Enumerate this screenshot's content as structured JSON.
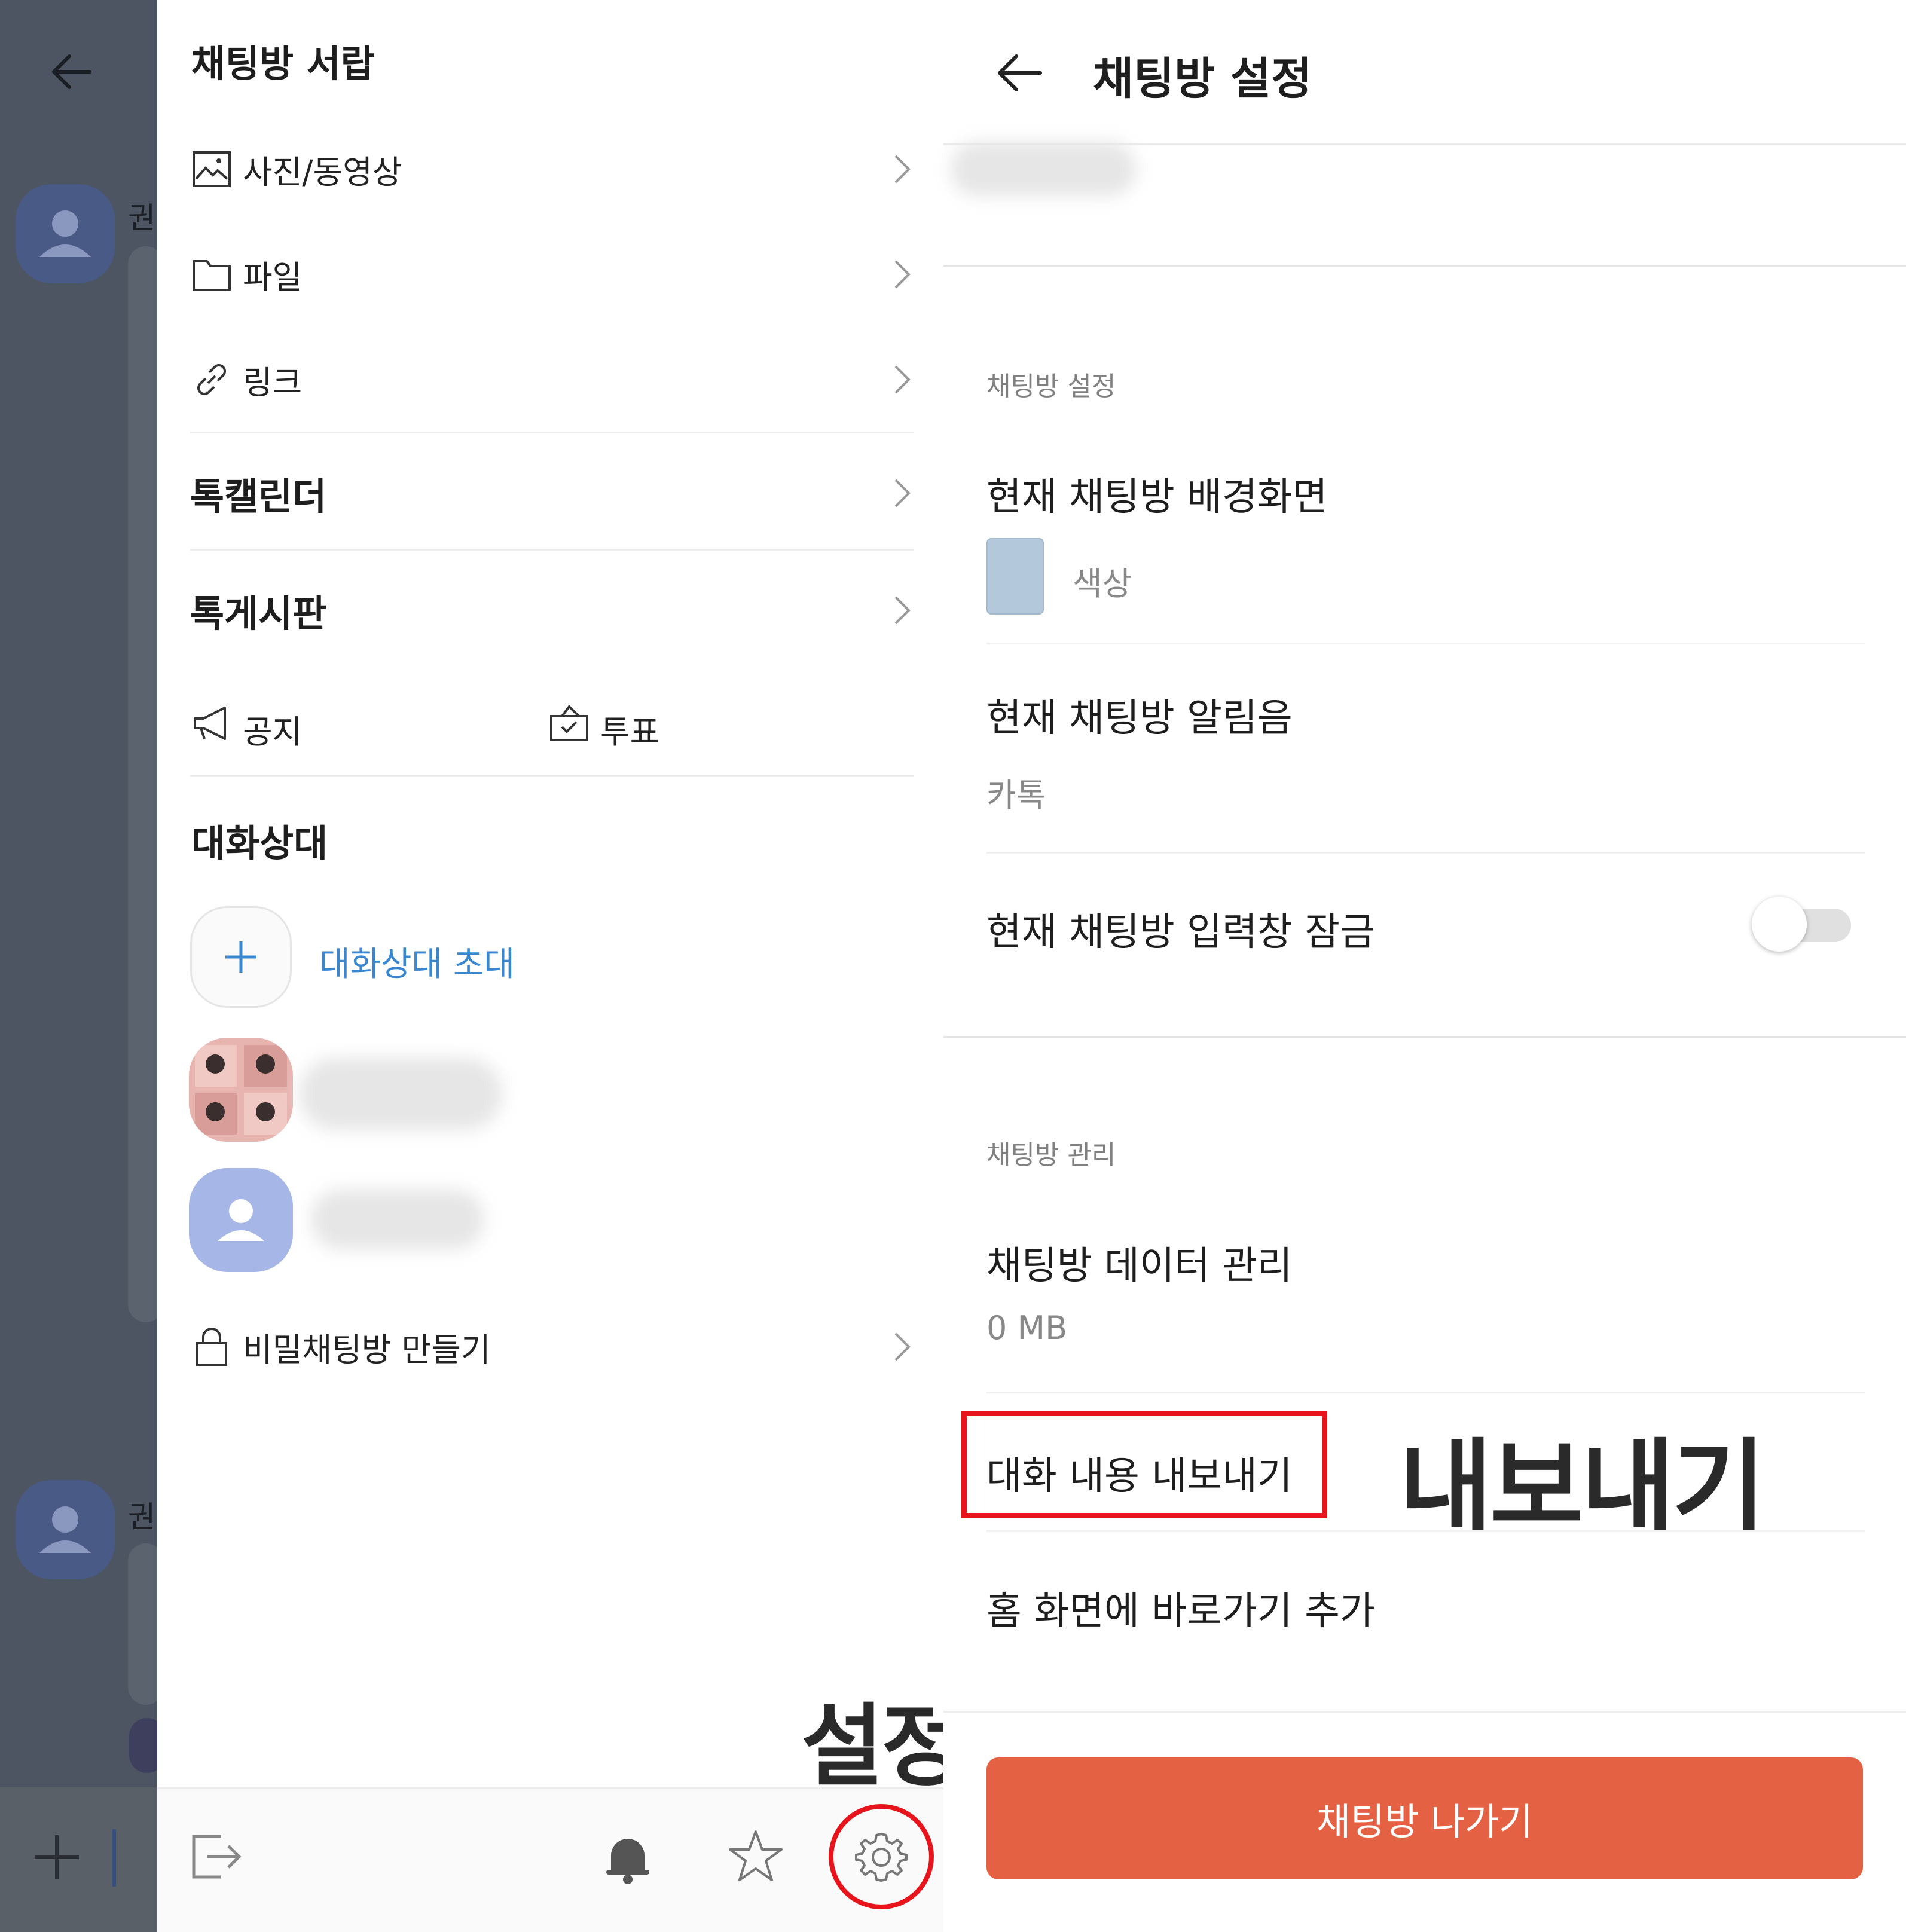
{
  "drawer": {
    "title": "채팅방 서랍",
    "media_items": [
      {
        "label": "사진/동영상",
        "icon": "image-icon"
      },
      {
        "label": "파일",
        "icon": "folder-icon"
      },
      {
        "label": "링크",
        "icon": "link-icon"
      }
    ],
    "talk_calendar": "톡캘린더",
    "talk_board": "톡게시판",
    "notice_label": "공지",
    "poll_label": "투표",
    "members_title": "대화상대",
    "invite_label": "대화상대 초대",
    "secret_chat_label": "비밀채팅방 만들기",
    "bottom_icons": [
      "exit-icon",
      "bell-icon",
      "star-icon",
      "gear-icon"
    ]
  },
  "background_chat": {
    "name_fragment": "권"
  },
  "annotations": {
    "settings_label": "설정",
    "export_label": "내보내기",
    "highlight_color": "#e8141b"
  },
  "panel": {
    "title": "채팅방 설정",
    "section_settings": "채팅방 설정",
    "wallpaper_title": "현재 채팅방 배경화면",
    "wallpaper_value": "색상",
    "wallpaper_swatch_color": "#b4c8dc",
    "sound_title": "현재 채팅방 알림음",
    "sound_value": "카톡",
    "lock_title": "현재 채팅방 입력창 잠금",
    "lock_enabled": false,
    "section_manage": "채팅방 관리",
    "data_title": "채팅방 데이터 관리",
    "data_value": "0 MB",
    "export_title": "대화 내용 내보내기",
    "shortcut_title": "홈 화면에 바로가기 추가",
    "leave_button": "채팅방 나가기",
    "leave_button_color": "#e56143"
  },
  "colors": {
    "invite_text": "#3a86cf",
    "overlay": "#4c5561"
  }
}
